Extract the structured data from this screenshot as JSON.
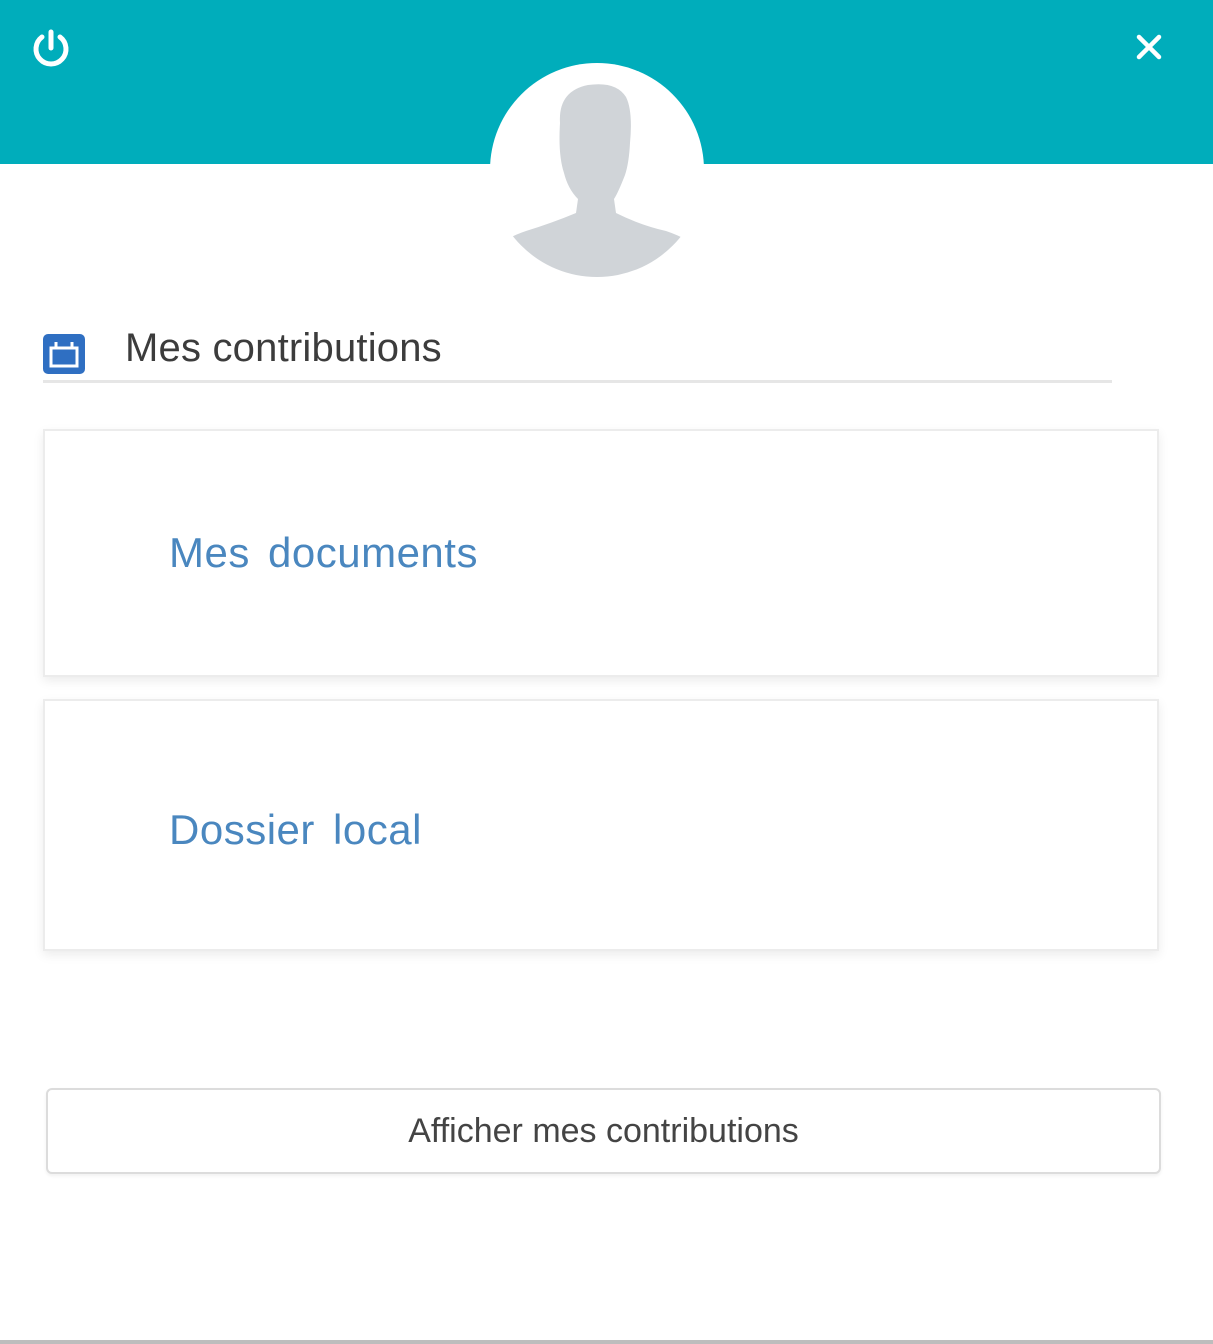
{
  "header": {
    "background_color": "#00adbb",
    "power_icon": "power-icon",
    "close_icon": "close-icon"
  },
  "avatar": {
    "icon": "user-silhouette-icon"
  },
  "section": {
    "icon": "contributions-icon",
    "title": "Mes contributions"
  },
  "cards": [
    {
      "label": "Mes documents"
    },
    {
      "label": "Dossier local"
    }
  ],
  "actions": {
    "show_contributions_label": "Afficher mes contributions"
  },
  "colors": {
    "accent": "#00adbb",
    "link": "#4a87bf",
    "icon_blue": "#2f6fc2"
  }
}
